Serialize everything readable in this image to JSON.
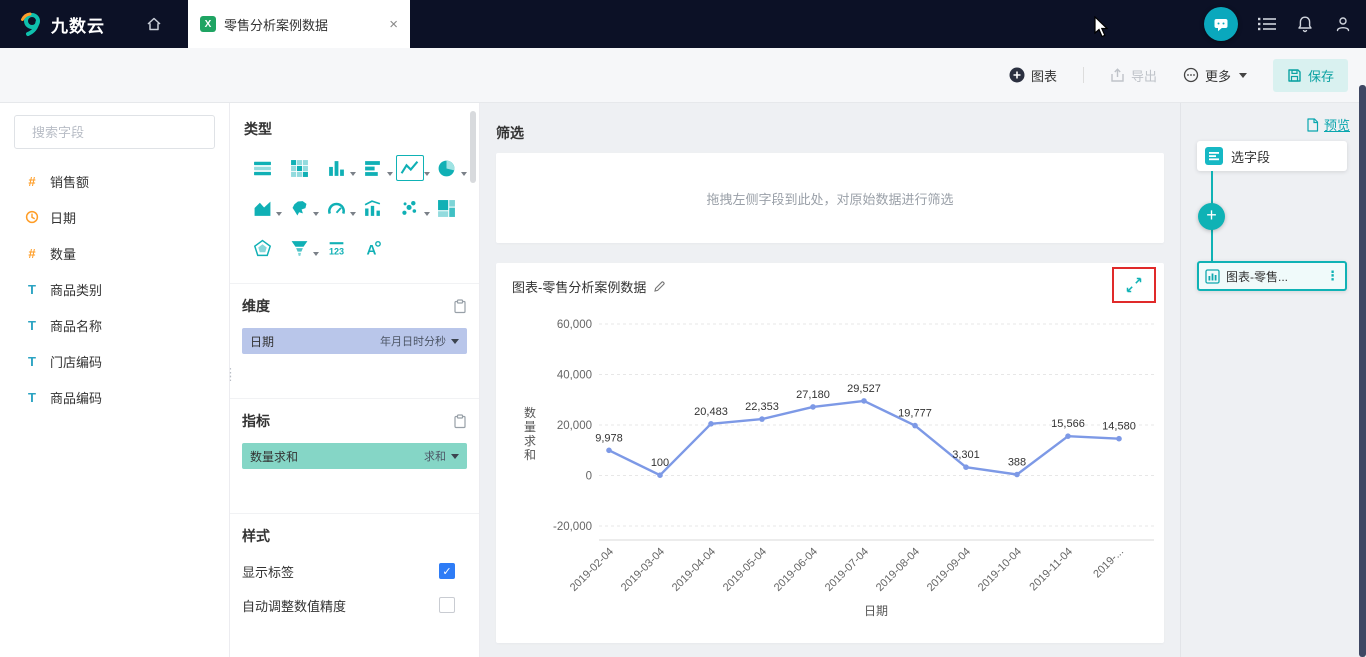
{
  "topbar": {
    "logo_text": "九数云",
    "tab_icon_letter": "X",
    "tab_label": "零售分析案例数据",
    "tab_close": "×",
    "icons": [
      "home-icon",
      "chat-support-icon",
      "task-list-icon",
      "bell-icon",
      "user-icon"
    ]
  },
  "toolbar": {
    "add_chart_label": "图表",
    "export_label": "导出",
    "more_label": "更多",
    "save_label": "保存"
  },
  "fields_panel": {
    "search_placeholder": "搜索字段",
    "fields": [
      {
        "type": "number",
        "label": "销售额"
      },
      {
        "type": "date",
        "label": "日期"
      },
      {
        "type": "number",
        "label": "数量"
      },
      {
        "type": "text",
        "label": "商品类别"
      },
      {
        "type": "text",
        "label": "商品名称"
      },
      {
        "type": "text",
        "label": "门店编码"
      },
      {
        "type": "text",
        "label": "商品编码"
      }
    ]
  },
  "config_panel": {
    "type_title": "类型",
    "type_icons": [
      {
        "name": "group-table-icon",
        "caret": false,
        "selected": false
      },
      {
        "name": "cross-table-icon",
        "caret": false,
        "selected": false
      },
      {
        "name": "column-chart-icon",
        "caret": true,
        "selected": false
      },
      {
        "name": "bar-chart-icon",
        "caret": true,
        "selected": false
      },
      {
        "name": "line-chart-icon",
        "caret": true,
        "selected": true
      },
      {
        "name": "pie-chart-icon",
        "caret": true,
        "selected": false
      },
      {
        "name": "area-chart-icon",
        "caret": true,
        "selected": false
      },
      {
        "name": "map-chart-icon",
        "caret": true,
        "selected": false
      },
      {
        "name": "gauge-chart-icon",
        "caret": true,
        "selected": false
      },
      {
        "name": "combo-chart-icon",
        "caret": false,
        "selected": false
      },
      {
        "name": "scatter-chart-icon",
        "caret": true,
        "selected": false
      },
      {
        "name": "treemap-chart-icon",
        "caret": false,
        "selected": false
      },
      {
        "name": "radar-chart-icon",
        "caret": false,
        "selected": false
      },
      {
        "name": "funnel-chart-icon",
        "caret": true,
        "selected": false
      },
      {
        "name": "kpi-card-icon",
        "caret": false,
        "selected": false
      },
      {
        "name": "wordcloud-icon",
        "caret": false,
        "selected": false
      }
    ],
    "dimension_title": "维度",
    "dimension_field": {
      "label": "日期",
      "format": "年月日时分秒"
    },
    "measure_title": "指标",
    "measure_field": {
      "label": "数量求和",
      "agg": "求和"
    },
    "style_title": "样式",
    "style_options": [
      {
        "label": "显示标签",
        "checked": true
      },
      {
        "label": "自动调整数值精度",
        "checked": false
      }
    ]
  },
  "main": {
    "filter_title": "筛选",
    "filter_hint": "拖拽左侧字段到此处，对原始数据进行筛选",
    "chart_card_title": "图表-零售分析案例数据"
  },
  "chart_data": {
    "type": "line",
    "title": "图表-零售分析案例数据",
    "x_labels": [
      "2019-02-04",
      "2019-03-04",
      "2019-04-04",
      "2019-05-04",
      "2019-06-04",
      "2019-07-04",
      "2019-08-04",
      "2019-09-04",
      "2019-10-04",
      "2019-11-04",
      "2019-..."
    ],
    "values": [
      9978,
      100,
      20483,
      22353,
      27180,
      29527,
      19777,
      3301,
      388,
      15566,
      14580
    ],
    "value_labels": [
      "9,978",
      "100",
      "20,483",
      "22,353",
      "27,180",
      "29,527",
      "19,777",
      "3,301",
      "388",
      "15,566",
      "14,580"
    ],
    "xlabel": "日期",
    "ylabel": "数量求和",
    "ylim": [
      -20000,
      60000
    ],
    "ytick_values": [
      60000,
      40000,
      20000,
      0,
      -20000
    ],
    "ytick_labels": [
      "60,000",
      "40,000",
      "20,000",
      "0",
      "-20,000"
    ],
    "line_color": "#7d99e6",
    "grid": true,
    "legend": "none"
  },
  "flow_panel": {
    "preview_label": "预览",
    "node_fields_label": "选字段",
    "add_button_glyph": "+",
    "node_chart_label": "图表-零售...",
    "accent_color": "#0fb2b5"
  }
}
